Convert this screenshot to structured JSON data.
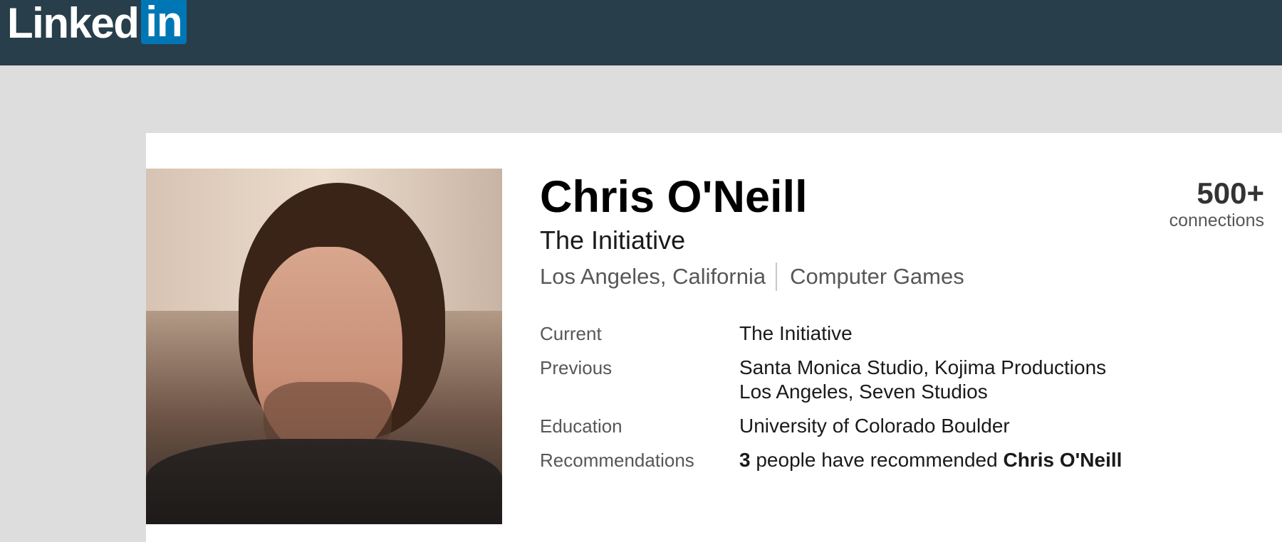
{
  "header": {
    "logo_text": "Linked",
    "logo_box": "in"
  },
  "profile": {
    "name": "Chris O'Neill",
    "headline": "The Initiative",
    "location": "Los Angeles, California",
    "industry": "Computer Games",
    "connections_count": "500+",
    "connections_label": "connections",
    "rows": [
      {
        "label": "Current",
        "value": "The Initiative"
      },
      {
        "label": "Previous",
        "value": "Santa Monica Studio, Kojima Productions Los Angeles, Seven Studios"
      },
      {
        "label": "Education",
        "value": "University of Colorado Boulder"
      },
      {
        "label": "Recommendations",
        "count": "3",
        "text": " people have recommended ",
        "who": "Chris O'Neill"
      }
    ]
  },
  "colors": {
    "topbar": "#283e4a",
    "logo_blue": "#0077b5",
    "page_bg": "#dddddd"
  }
}
